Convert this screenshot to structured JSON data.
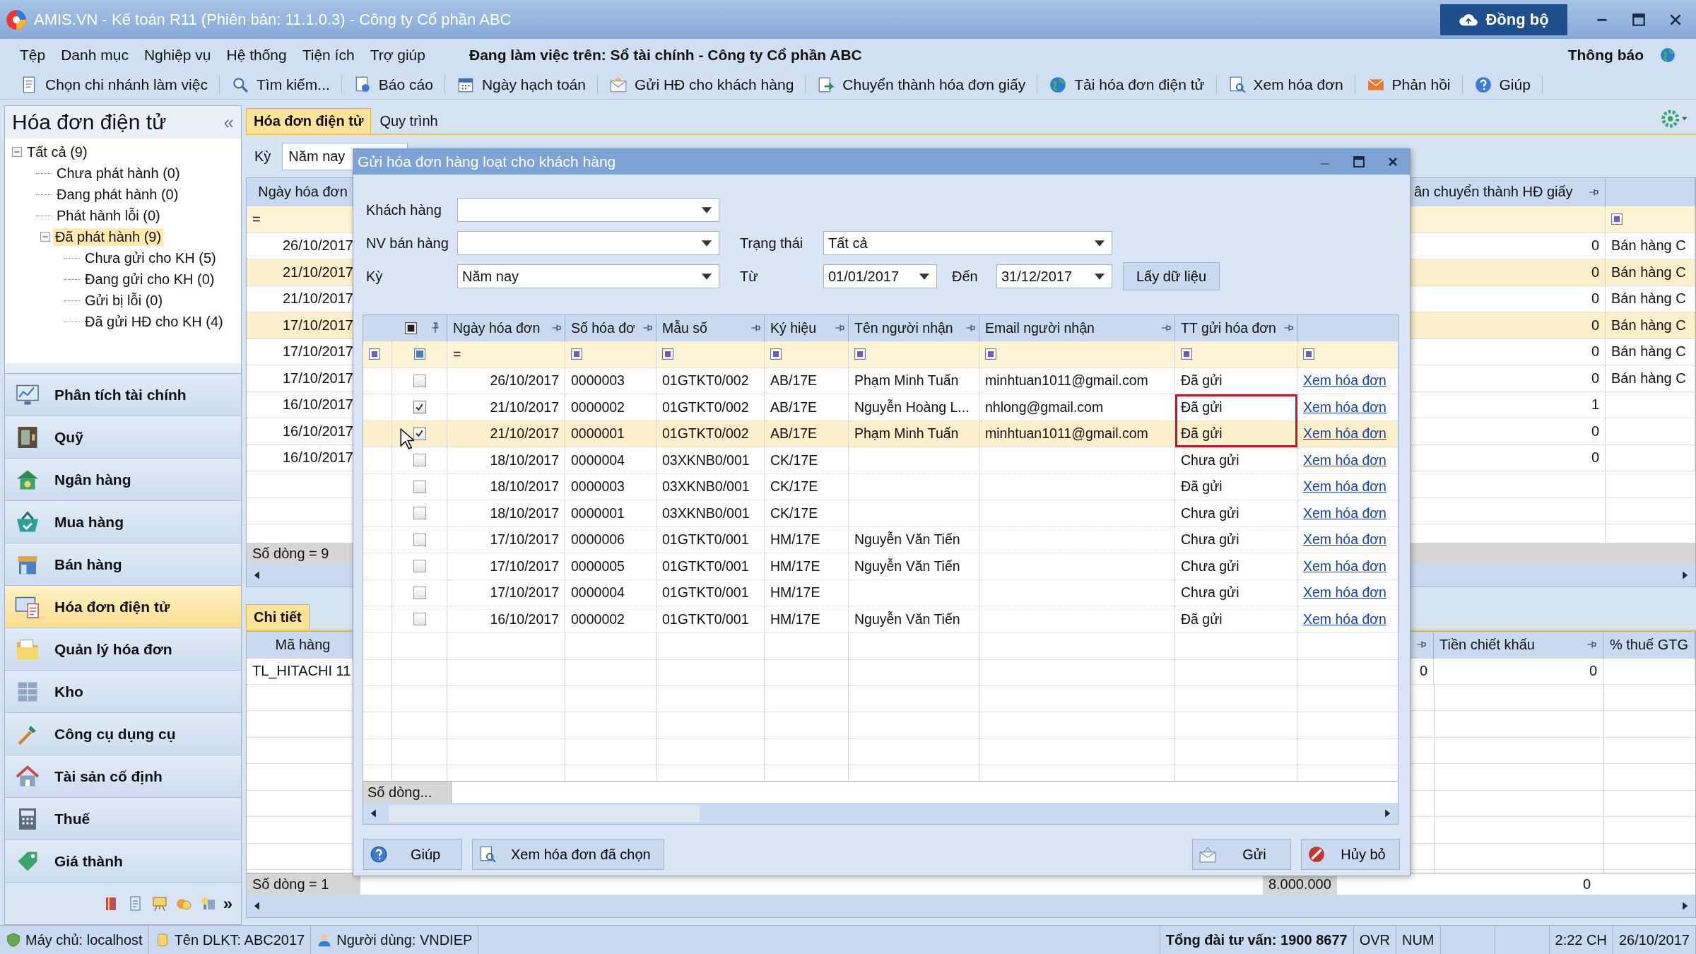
{
  "window": {
    "title": "AMIS.VN - Kế toán R11 (Phiên bản: 11.1.0.3) - Công ty Cổ phần ABC",
    "sync_button": "Đồng bộ"
  },
  "menu": {
    "items": [
      "Tệp",
      "Danh mục",
      "Nghiệp vụ",
      "Hệ thống",
      "Tiện ích",
      "Trợ giúp"
    ],
    "context": "Đang làm việc trên: Sổ tài chính - Công ty Cổ phần ABC",
    "notifications": "Thông báo"
  },
  "toolbar": [
    "Chọn chi nhánh làm việc",
    "Tìm kiếm...",
    "Báo cáo",
    "Ngày hạch toán",
    "Gửi HĐ cho khách hàng",
    "Chuyển thành hóa đơn giấy",
    "Tải hóa đơn điện tử",
    "Xem hóa đơn",
    "Phản hồi",
    "Giúp"
  ],
  "sidebar": {
    "title": "Hóa đơn điện tử",
    "collapse": "«",
    "tree": [
      {
        "label": "Tất cả (9)",
        "expanded": true,
        "selected": false,
        "children": [
          {
            "label": "Chưa phát hành (0)",
            "selected": false
          },
          {
            "label": "Đang phát hành (0)",
            "selected": false
          },
          {
            "label": "Phát hành lỗi (0)",
            "selected": false
          },
          {
            "label": "Đã phát hành (9)",
            "expanded": true,
            "selected": true,
            "children": [
              {
                "label": "Chưa gửi cho KH (5)",
                "selected": false
              },
              {
                "label": "Đang gửi cho KH (0)",
                "selected": false
              },
              {
                "label": "Gửi bị lỗi (0)",
                "selected": false
              },
              {
                "label": "Đã gửi HĐ cho KH (4)",
                "selected": false
              }
            ]
          }
        ]
      }
    ],
    "modules": [
      {
        "label": "Phân tích tài chính",
        "selected": false
      },
      {
        "label": "Quỹ",
        "selected": false
      },
      {
        "label": "Ngân hàng",
        "selected": false
      },
      {
        "label": "Mua hàng",
        "selected": false
      },
      {
        "label": "Bán hàng",
        "selected": false
      },
      {
        "label": "Hóa đơn điện tử",
        "selected": true
      },
      {
        "label": "Quản lý hóa đơn",
        "selected": false
      },
      {
        "label": "Kho",
        "selected": false
      },
      {
        "label": "Công cụ dụng cụ",
        "selected": false
      },
      {
        "label": "Tài sản cố định",
        "selected": false
      },
      {
        "label": "Thuế",
        "selected": false
      },
      {
        "label": "Giá thành",
        "selected": false
      }
    ],
    "more": "»"
  },
  "content": {
    "tabs": [
      {
        "label": "Hóa đơn điện tử",
        "selected": true
      },
      {
        "label": "Quy trình",
        "selected": false
      }
    ],
    "period_label": "Kỳ",
    "period_value": "Năm nay",
    "grid": {
      "columns": [
        "Ngày hóa đơn",
        "ân chuyển thành HĐ giấy"
      ],
      "filter": "=",
      "rows": [
        {
          "date": "26/10/2017",
          "converted": "0",
          "description": "Bán hàng C",
          "selected": false
        },
        {
          "date": "21/10/2017",
          "converted": "0",
          "description": "Bán hàng C",
          "selected": true
        },
        {
          "date": "21/10/2017",
          "converted": "0",
          "description": "Bán hàng C",
          "selected": false
        },
        {
          "date": "17/10/2017",
          "converted": "0",
          "description": "Bán hàng C",
          "selected": true
        },
        {
          "date": "17/10/2017",
          "converted": "0",
          "description": "Bán hàng C",
          "selected": false
        },
        {
          "date": "17/10/2017",
          "converted": "0",
          "description": "Bán hàng C",
          "selected": false
        },
        {
          "date": "16/10/2017",
          "converted": "1",
          "selected": false
        },
        {
          "date": "16/10/2017",
          "converted": "0",
          "selected": false
        },
        {
          "date": "16/10/2017",
          "converted": "0",
          "selected": false
        }
      ],
      "footer": "Số dòng = 9"
    },
    "detail": {
      "tab": "Chi tiết",
      "columns": [
        "Mã hàng",
        "Tiền chiết khấu",
        "% thuế GTG"
      ],
      "rows": [
        {
          "code": "TL_HITACHI 11",
          "column_2": "0",
          "discount": "0"
        }
      ],
      "footer": "Số dòng = 1",
      "total": "8.000.000",
      "total_2": "0"
    }
  },
  "dialog": {
    "title": "Gửi hóa đơn hàng loạt cho khách hàng",
    "customer": {
      "label": "Khách hàng"
    },
    "salesperson": {
      "label": "NV bán hàng"
    },
    "status": {
      "label": "Trạng thái",
      "value": "Tất cả"
    },
    "period": {
      "label": "Kỳ",
      "value": "Năm nay"
    },
    "from": {
      "label": "Từ",
      "value": "01/01/2017"
    },
    "to": {
      "label": "Đến",
      "value": "31/12/2017"
    },
    "fetch_button": "Lấy dữ liệu",
    "grid": {
      "select_all_partial": true,
      "columns": [
        "Ngày hóa đơn",
        "Số hóa đơ",
        "Mẫu số",
        "Ký hiệu",
        "Tên người nhận",
        "Email người nhận",
        "TT gửi hóa đơn"
      ],
      "filter": "=",
      "rows": [
        {
          "date": "26/10/2017",
          "number": "0000003",
          "template": "01GTKT0/002",
          "series": "AB/17E",
          "recipient": "Phạm Minh Tuấn",
          "email": "minhtuan1011@gmail.com",
          "status": "Đã gửi",
          "link": "Xem hóa đơn",
          "checked": false,
          "selected": false,
          "flagged": false
        },
        {
          "date": "21/10/2017",
          "number": "0000002",
          "template": "01GTKT0/002",
          "series": "AB/17E",
          "recipient": "Nguyễn Hoàng L...",
          "email": "nhlong@gmail.com",
          "status": "Đã gửi",
          "link": "Xem hóa đơn",
          "checked": true,
          "selected": false,
          "flagged": true
        },
        {
          "date": "21/10/2017",
          "number": "0000001",
          "template": "01GTKT0/002",
          "series": "AB/17E",
          "recipient": "Phạm Minh Tuấn",
          "email": "minhtuan1011@gmail.com",
          "status": "Đã gửi",
          "link": "Xem hóa đơn",
          "checked": true,
          "selected": true,
          "flagged": true
        },
        {
          "date": "18/10/2017",
          "number": "0000004",
          "template": "03XKNB0/001",
          "series": "CK/17E",
          "status": "Chưa gửi",
          "link": "Xem hóa đơn",
          "checked": false,
          "selected": false,
          "flagged": false
        },
        {
          "date": "18/10/2017",
          "number": "0000003",
          "template": "03XKNB0/001",
          "series": "CK/17E",
          "status": "Đã gửi",
          "link": "Xem hóa đơn",
          "checked": false,
          "selected": false,
          "flagged": false
        },
        {
          "date": "18/10/2017",
          "number": "0000001",
          "template": "03XKNB0/001",
          "series": "CK/17E",
          "status": "Chưa gửi",
          "link": "Xem hóa đơn",
          "checked": false,
          "selected": false,
          "flagged": false
        },
        {
          "date": "17/10/2017",
          "number": "0000006",
          "template": "01GTKT0/001",
          "series": "HM/17E",
          "recipient": "Nguyễn Văn Tiến",
          "status": "Chưa gửi",
          "link": "Xem hóa đơn",
          "checked": false,
          "selected": false,
          "flagged": false
        },
        {
          "date": "17/10/2017",
          "number": "0000005",
          "template": "01GTKT0/001",
          "series": "HM/17E",
          "recipient": "Nguyễn Văn Tiến",
          "status": "Chưa gửi",
          "link": "Xem hóa đơn",
          "checked": false,
          "selected": false,
          "flagged": false
        },
        {
          "date": "17/10/2017",
          "number": "0000004",
          "template": "01GTKT0/001",
          "series": "HM/17E",
          "status": "Chưa gửi",
          "link": "Xem hóa đơn",
          "checked": false,
          "selected": false,
          "flagged": false
        },
        {
          "date": "16/10/2017",
          "number": "0000002",
          "template": "01GTKT0/001",
          "series": "HM/17E",
          "recipient": "Nguyễn Văn Tiến",
          "status": "Đã gửi",
          "link": "Xem hóa đơn",
          "checked": false,
          "selected": false,
          "flagged": false
        }
      ],
      "footer": "Số dòng..."
    },
    "buttons": {
      "help": "Giúp",
      "view_selected": "Xem hóa đơn đã chọn",
      "send": "Gửi",
      "cancel": "Hủy bỏ"
    }
  },
  "status_bar": {
    "server": "Máy chủ: localhost",
    "database": "Tên DLKT: ABC2017",
    "user": "Người dùng: VNDIEP",
    "hotline": "Tổng đài tư vấn: 1900 8677",
    "mode_1": "OVR",
    "mode_2": "NUM",
    "time": "2:22 CH",
    "date": "26/10/2017"
  }
}
